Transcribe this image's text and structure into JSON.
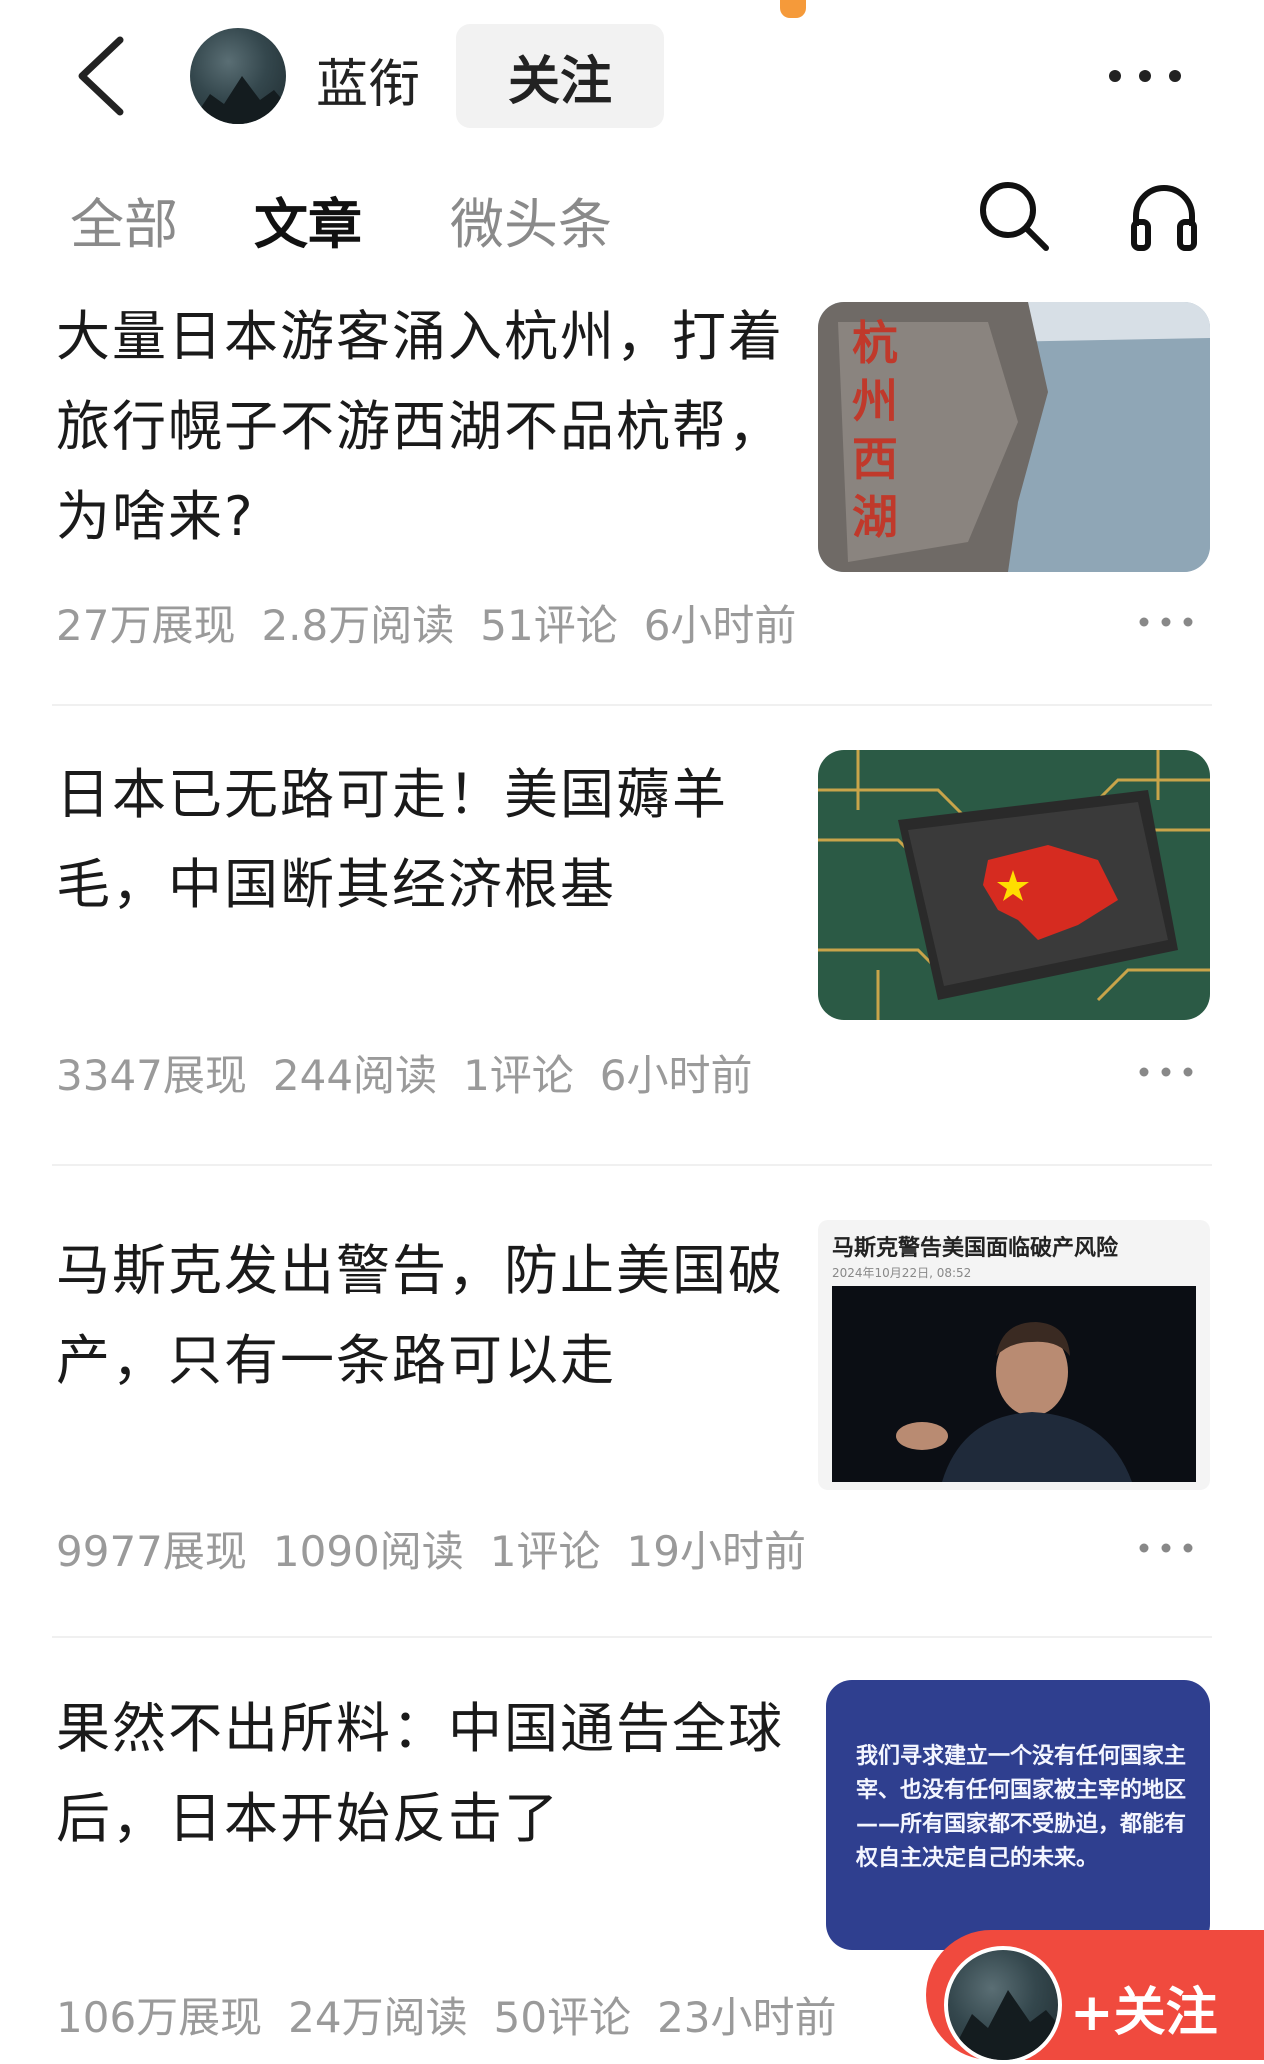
{
  "header": {
    "username": "蓝衔",
    "follow_label": "关注"
  },
  "tabs": [
    {
      "label": "全部",
      "active": false
    },
    {
      "label": "文章",
      "active": true
    },
    {
      "label": "微头条",
      "active": false
    }
  ],
  "articles": [
    {
      "title": "大量日本游客涌入杭州，打着旅行幌子不游西湖不品杭帮，为啥来?",
      "impressions": "27万展现",
      "reads": "2.8万阅读",
      "comments": "51评论",
      "time": "6小时前",
      "thumb_text": "杭州西湖"
    },
    {
      "title": "日本已无路可走！美国薅羊毛，中国断其经济根基",
      "impressions": "3347展现",
      "reads": "244阅读",
      "comments": "1评论",
      "time": "6小时前"
    },
    {
      "title": "马斯克发出警告，防止美国破产，只有一条路可以走",
      "impressions": "9977展现",
      "reads": "1090阅读",
      "comments": "1评论",
      "time": "19小时前",
      "thumb_headline": "马斯克警告美国面临破产风险",
      "thumb_date": "2024年10月22日, 08:52"
    },
    {
      "title": "果然不出所料：中国通告全球后，日本开始反击了",
      "impressions": "106万展现",
      "reads": "24万阅读",
      "comments": "50评论",
      "time": "23小时前",
      "thumb_quote": "我们寻求建立一个没有任何国家主宰、也没有任何国家被主宰的地区——所有国家都不受胁迫，都能有权自主决定自己的未来。"
    }
  ],
  "floating": {
    "label": "+关注"
  },
  "colors": {
    "accent": "#f04a3e",
    "meta": "#9a9a9a"
  }
}
